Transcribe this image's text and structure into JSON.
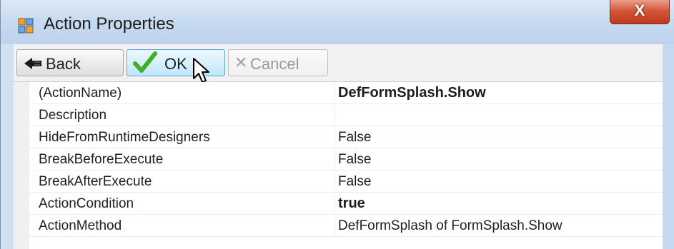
{
  "window": {
    "title": "Action Properties",
    "close_label": "X"
  },
  "toolbar": {
    "back_label": "Back",
    "ok_label": "OK",
    "cancel_label": "Cancel"
  },
  "icons": {
    "title": "properties-window-icon",
    "back": "back-arrow-icon",
    "ok": "green-check-icon",
    "cancel": "gray-x-icon",
    "cursor": "mouse-pointer-icon"
  },
  "colors": {
    "title_bar": "#c7dbf0",
    "close_button": "#c8452a",
    "ok_highlight": "#bee6fd",
    "ok_check": "#3fae29"
  },
  "properties": [
    {
      "name": "(ActionName)",
      "value": "DefFormSplash.Show",
      "bold": true
    },
    {
      "name": "Description",
      "value": "",
      "bold": false
    },
    {
      "name": "HideFromRuntimeDesigners",
      "value": "False",
      "bold": false
    },
    {
      "name": "BreakBeforeExecute",
      "value": "False",
      "bold": false
    },
    {
      "name": "BreakAfterExecute",
      "value": "False",
      "bold": false
    },
    {
      "name": "ActionCondition",
      "value": "true",
      "bold": true
    },
    {
      "name": "ActionMethod",
      "value": "DefFormSplash of FormSplash.Show",
      "bold": false
    }
  ]
}
